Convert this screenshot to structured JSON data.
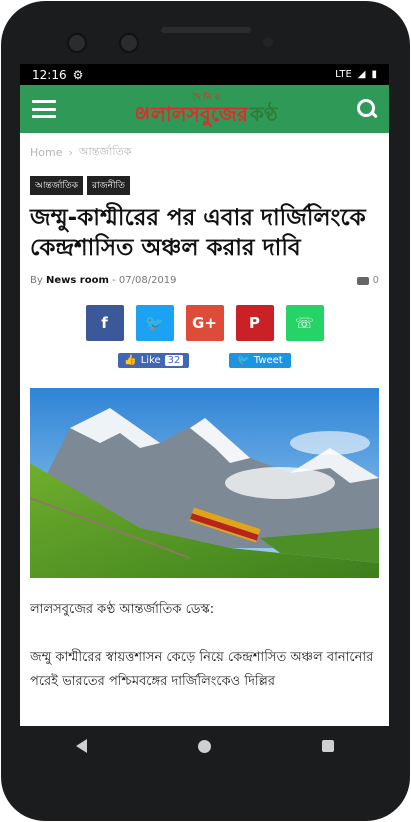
{
  "status": {
    "time": "12:16",
    "network": "LTE"
  },
  "app": {
    "brand_small": "দৈ নি ক",
    "brand_red": "লালসবুজের",
    "brand_green": "কণ্ঠ"
  },
  "breadcrumb": {
    "home": "Home",
    "sep": "›",
    "section": "আন্তর্জাতিক"
  },
  "tags": [
    "আন্তর্জাতিক",
    "রাজনীতি"
  ],
  "article": {
    "title": "জম্মু-কাশ্মীরের পর এবার দার্জিলিংকে কেন্দ্রশাসিত অঞ্চল করার দাবি",
    "by": "By",
    "author": "News room",
    "dash": "-",
    "date": "07/08/2019",
    "comments": "0",
    "para1": "লালসবুজের কণ্ঠ আন্তর্জাতিক ডেস্ক:",
    "para2": "জম্মু কাশ্মীরের স্বায়ত্তশাসন কেড়ে নিয়ে কেন্দ্রশাসিত অঞ্চল বানানোর পরেই ভারতের পশ্চিমবঙ্গের দার্জিলিংকেও দিল্লির"
  },
  "share": [
    {
      "label": "f",
      "color": "#3b5998",
      "icon": "facebook-icon"
    },
    {
      "label": "🐦",
      "color": "#1da1f2",
      "icon": "twitter-icon"
    },
    {
      "label": "G+",
      "color": "#dd4b39",
      "icon": "google-plus-icon"
    },
    {
      "label": "P",
      "color": "#ca2127",
      "icon": "pinterest-icon"
    },
    {
      "label": "☏",
      "color": "#25d366",
      "icon": "whatsapp-icon"
    }
  ],
  "social": {
    "like_label": "Like",
    "like_count": "32",
    "tweet_label": "Tweet"
  },
  "colors": {
    "appbar": "#2f9a57",
    "brand_red": "#e12b2b"
  }
}
